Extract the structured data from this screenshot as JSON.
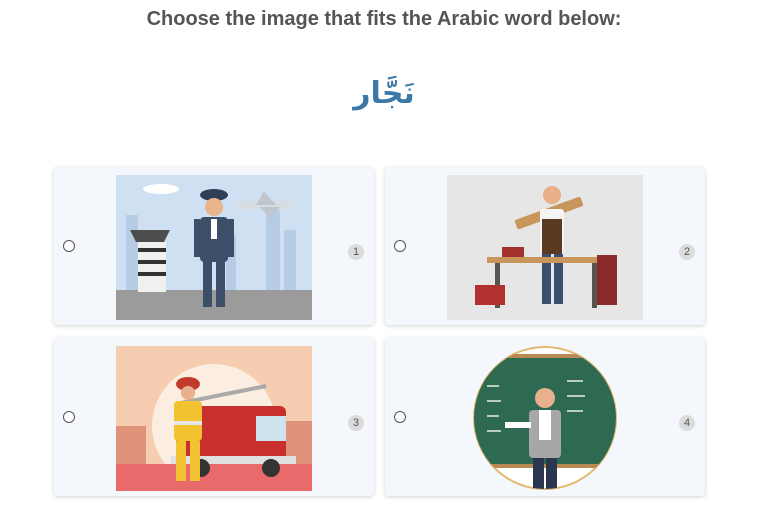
{
  "question": "Choose the image that fits the Arabic word below:",
  "word": "نَجَّار",
  "options": [
    {
      "number": "1",
      "image": "pilot-image"
    },
    {
      "number": "2",
      "image": "carpenter-image"
    },
    {
      "number": "3",
      "image": "firefighter-image"
    },
    {
      "number": "4",
      "image": "teacher-image"
    }
  ],
  "colors": {
    "word": "#3a78a8",
    "card_bg": "#f4f8fc"
  }
}
